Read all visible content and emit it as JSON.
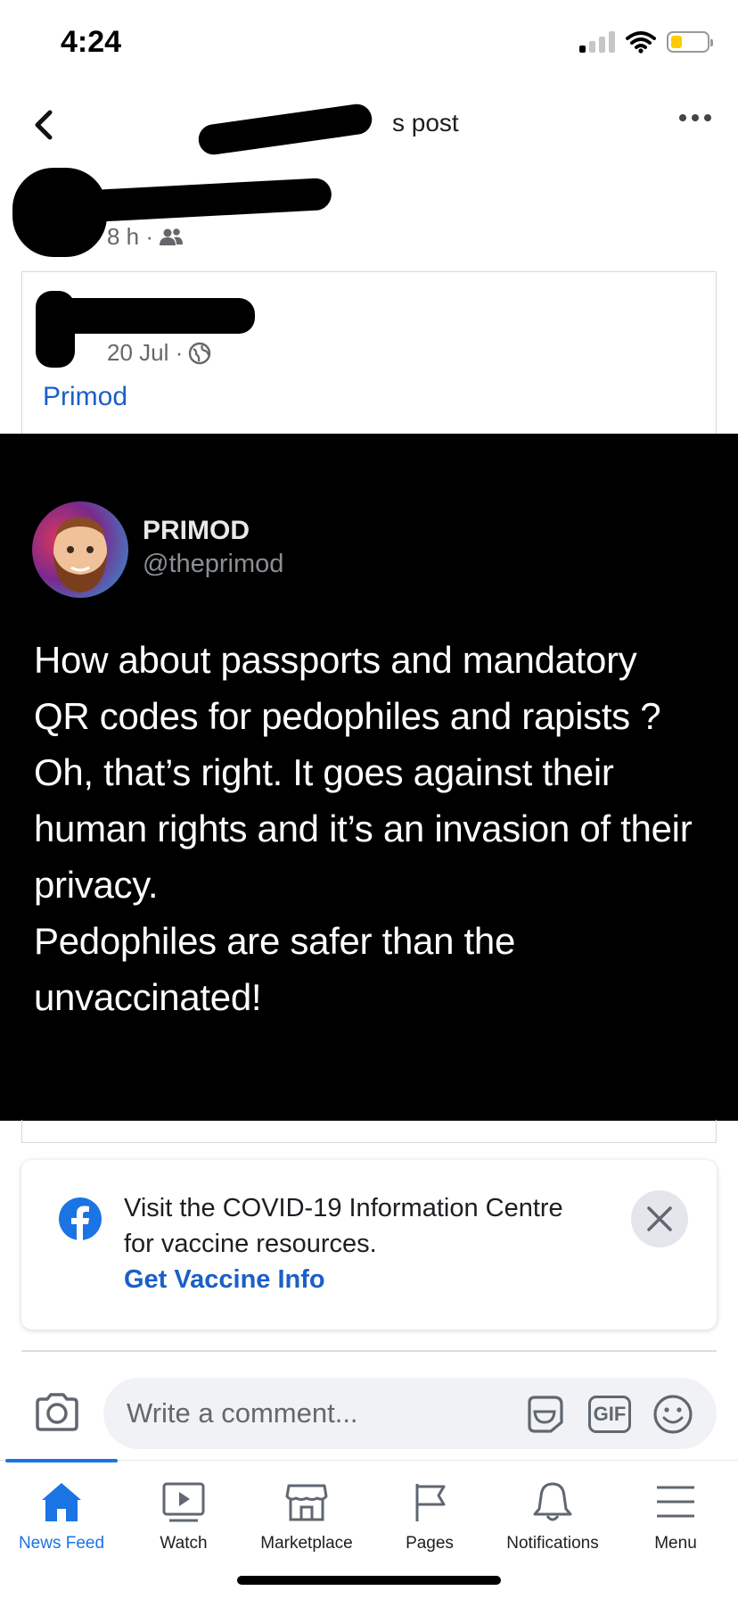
{
  "status_bar": {
    "time": "4:24"
  },
  "header": {
    "title": "s post"
  },
  "sharer": {
    "time": "8 h ·"
  },
  "shared_post": {
    "date": "20 Jul ·",
    "link_text": "Primod"
  },
  "tweet": {
    "name": "PRIMOD",
    "handle": "@theprimod",
    "text": "How about passports and mandatory\nQR codes for pedophiles and rapists ?\nOh, that’s right. It goes against their\nhuman rights and it’s an invasion of their\nprivacy.\nPedophiles are safer than the\nunvaccinated!"
  },
  "covid_card": {
    "message": "Visit the COVID-19 Information Centre for vaccine resources.",
    "link": "Get Vaccine Info"
  },
  "comment_bar": {
    "placeholder": "Write a comment...",
    "gif_label": "GIF"
  },
  "tabs": [
    {
      "label": "News Feed",
      "icon": "home-icon",
      "active": true
    },
    {
      "label": "Watch",
      "icon": "watch-icon",
      "active": false
    },
    {
      "label": "Marketplace",
      "icon": "marketplace-icon",
      "active": false
    },
    {
      "label": "Pages",
      "icon": "flag-icon",
      "active": false
    },
    {
      "label": "Notifications",
      "icon": "bell-icon",
      "active": false
    },
    {
      "label": "Menu",
      "icon": "menu-icon",
      "active": false
    }
  ],
  "colors": {
    "facebook_blue": "#1b74e4",
    "link_blue": "#1b5fc7",
    "battery": "#ffcc00"
  }
}
